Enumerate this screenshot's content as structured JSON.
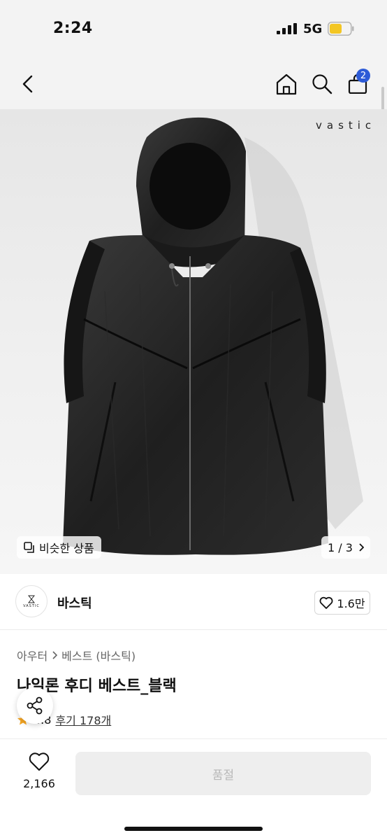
{
  "status_bar": {
    "time": "2:24",
    "network": "5G"
  },
  "nav": {
    "cart_count": "2"
  },
  "hero": {
    "brand_watermark": "vastic",
    "similar_label": "비슷한 상품",
    "page_indicator": "1 / 3"
  },
  "brand": {
    "logo_text": "VASTIC",
    "name": "바스틱",
    "likes": "1.6만"
  },
  "product": {
    "breadcrumb": [
      "아우터",
      "베스트 (바스틱)"
    ],
    "title": "나일론 후디 베스트_블랙",
    "rating": "4.8",
    "reviews": "후기 178개"
  },
  "bottom_bar": {
    "wish_count": "2,166",
    "soldout_label": "품절"
  },
  "colors": {
    "accent_badge": "#2d5bd7",
    "star": "#f5a623",
    "soldout_bg": "#eeeeee"
  }
}
